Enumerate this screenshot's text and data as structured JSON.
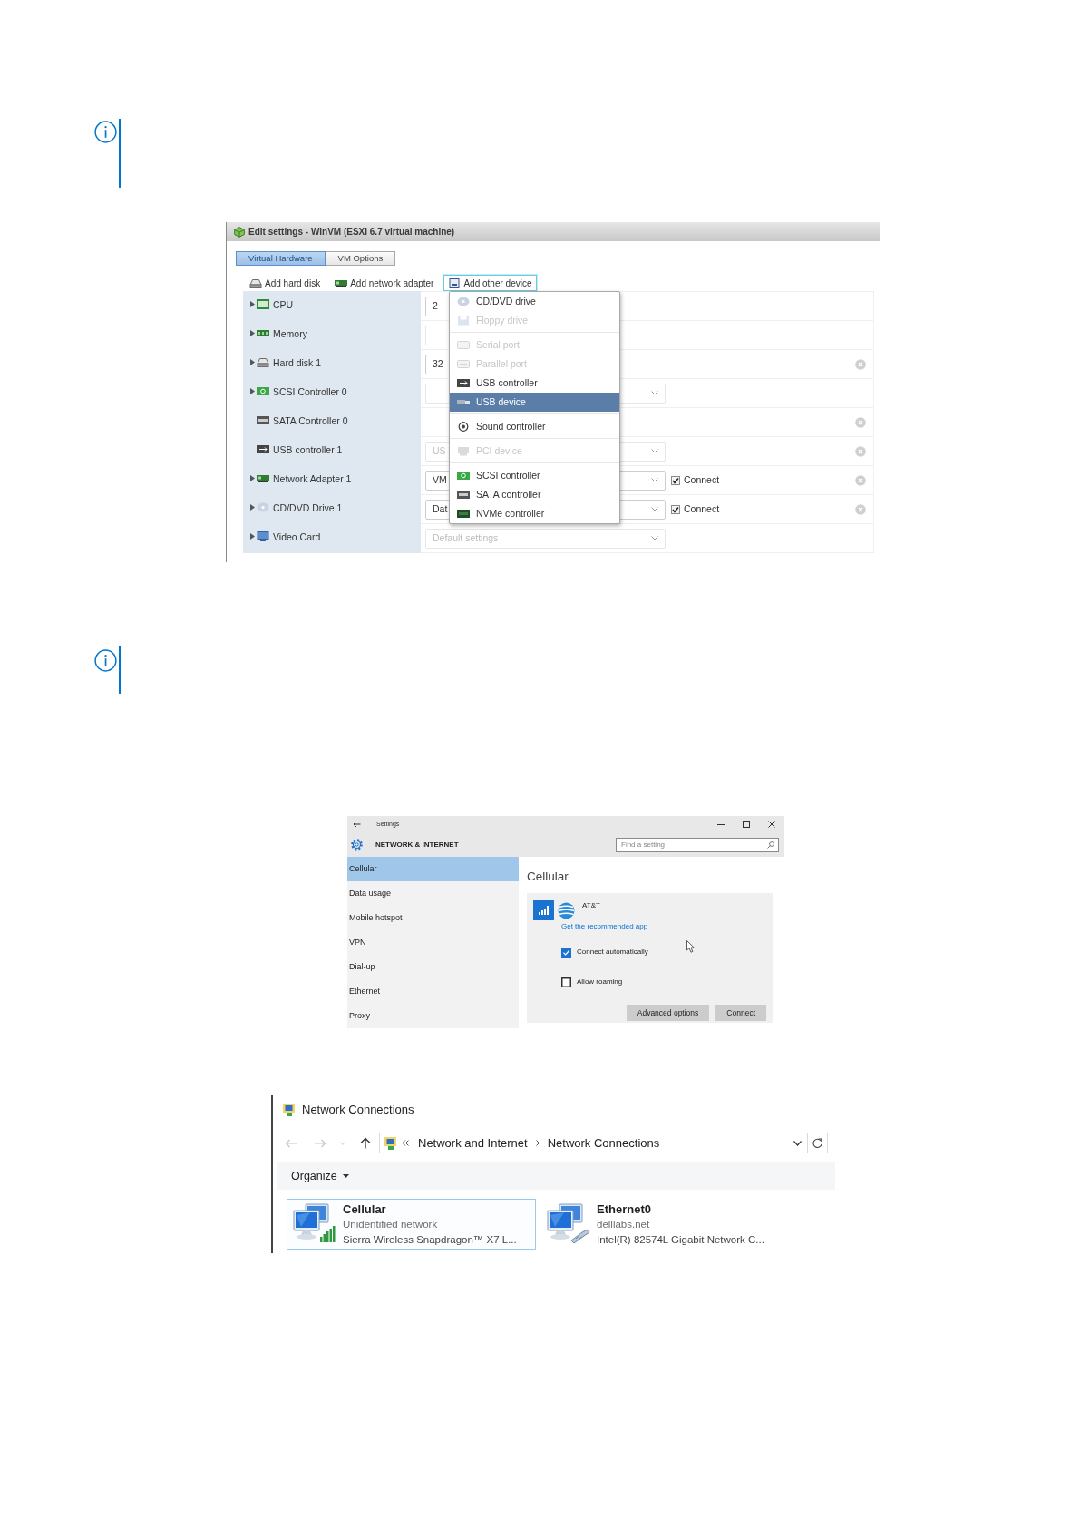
{
  "vm_settings": {
    "title": "Edit settings - WinVM (ESXi 6.7 virtual machine)",
    "tabs": [
      {
        "label": "Virtual Hardware",
        "selected": true
      },
      {
        "label": "VM Options",
        "selected": false
      }
    ],
    "toolbar": [
      {
        "label": "Add hard disk",
        "kind": "disk",
        "active": false
      },
      {
        "label": "Add network adapter",
        "kind": "nic",
        "active": false
      },
      {
        "label": "Add other device",
        "kind": "device",
        "active": true
      }
    ],
    "hardware": [
      {
        "label": "CPU",
        "kind": "cpu",
        "expandable": true,
        "field": {
          "kind": "text",
          "value": "2",
          "disabled": false
        },
        "removable": false
      },
      {
        "label": "Memory",
        "kind": "memory",
        "expandable": true,
        "field": {
          "kind": "text",
          "disabled": true
        },
        "removable": false
      },
      {
        "label": "Hard disk 1",
        "kind": "disk",
        "expandable": true,
        "field": {
          "kind": "text",
          "value": "32",
          "disabled": false
        },
        "removable": true
      },
      {
        "label": "SCSI Controller 0",
        "kind": "scsi",
        "expandable": true,
        "field": {
          "kind": "select",
          "disabled": true
        },
        "removable": false
      },
      {
        "label": "SATA Controller 0",
        "kind": "sata",
        "expandable": false,
        "removable": true
      },
      {
        "label": "USB controller 1",
        "kind": "usb",
        "expandable": false,
        "field": {
          "kind": "select",
          "value": "US",
          "disabled": true
        },
        "removable": true
      },
      {
        "label": "Network Adapter 1",
        "kind": "nic",
        "expandable": true,
        "field": {
          "kind": "select",
          "value": "VM",
          "disabled": false
        },
        "connect": {
          "label": "Connect",
          "checked": true
        },
        "removable": true
      },
      {
        "label": "CD/DVD Drive 1",
        "kind": "cdrom",
        "expandable": true,
        "field": {
          "kind": "select",
          "value": "Dat",
          "disabled": false
        },
        "connect": {
          "label": "Connect",
          "checked": true
        },
        "removable": true
      },
      {
        "label": "Video Card",
        "kind": "video",
        "expandable": true,
        "field": {
          "kind": "select",
          "value": "Default settings",
          "disabled": true
        },
        "removable": false
      }
    ],
    "menu": {
      "groups": [
        {
          "items": [
            {
              "label": "CD/DVD drive",
              "kind": "cdrom",
              "disabled": false,
              "selected": false
            },
            {
              "label": "Floppy drive",
              "kind": "floppy",
              "disabled": true,
              "selected": false
            }
          ]
        },
        {
          "items": [
            {
              "label": "Serial port",
              "kind": "serial",
              "disabled": true,
              "selected": false
            },
            {
              "label": "Parallel port",
              "kind": "parallel",
              "disabled": true,
              "selected": false
            },
            {
              "label": "USB controller",
              "kind": "usb",
              "disabled": false,
              "selected": false
            },
            {
              "label": "USB device",
              "kind": "usbdev",
              "disabled": false,
              "selected": true
            }
          ]
        },
        {
          "items": [
            {
              "label": "Sound controller",
              "kind": "sound",
              "disabled": false,
              "selected": false
            }
          ]
        },
        {
          "items": [
            {
              "label": "PCI device",
              "kind": "pci",
              "disabled": true,
              "selected": false
            }
          ]
        },
        {
          "items": [
            {
              "label": "SCSI controller",
              "kind": "scsi",
              "disabled": false,
              "selected": false
            },
            {
              "label": "SATA controller",
              "kind": "sata",
              "disabled": false,
              "selected": false
            },
            {
              "label": "NVMe controller",
              "kind": "nvme",
              "disabled": false,
              "selected": false
            }
          ]
        }
      ]
    }
  },
  "settings_window": {
    "title": "Settings",
    "header": "NETWORK & INTERNET",
    "search": {
      "placeholder": "Find a setting"
    },
    "nav": [
      {
        "label": "Cellular",
        "selected": true
      },
      {
        "label": "Data usage",
        "selected": false
      },
      {
        "label": "Mobile hotspot",
        "selected": false
      },
      {
        "label": "VPN",
        "selected": false
      },
      {
        "label": "Dial-up",
        "selected": false
      },
      {
        "label": "Ethernet",
        "selected": false
      },
      {
        "label": "Proxy",
        "selected": false
      }
    ],
    "page_title": "Cellular",
    "carrier": {
      "name": "AT&T",
      "link": "Get the recommended app"
    },
    "options": [
      {
        "label": "Connect automatically",
        "checked": true
      },
      {
        "label": "Allow roaming",
        "checked": false
      }
    ],
    "buttons": [
      "Advanced options",
      "Connect"
    ]
  },
  "network_connections": {
    "title": "Network Connections",
    "breadcrumb": [
      "Network and Internet",
      "Network Connections"
    ],
    "menu_button": "Organize",
    "connections": [
      {
        "name": "Cellular",
        "kind": "cellular",
        "selected": true,
        "status": "Unidentified network",
        "device": "Sierra Wireless Snapdragon™ X7 L..."
      },
      {
        "name": "Ethernet0",
        "kind": "ethernet",
        "selected": false,
        "status": "delllabs.net",
        "device": "Intel(R) 82574L Gigabit Network C..."
      }
    ]
  }
}
